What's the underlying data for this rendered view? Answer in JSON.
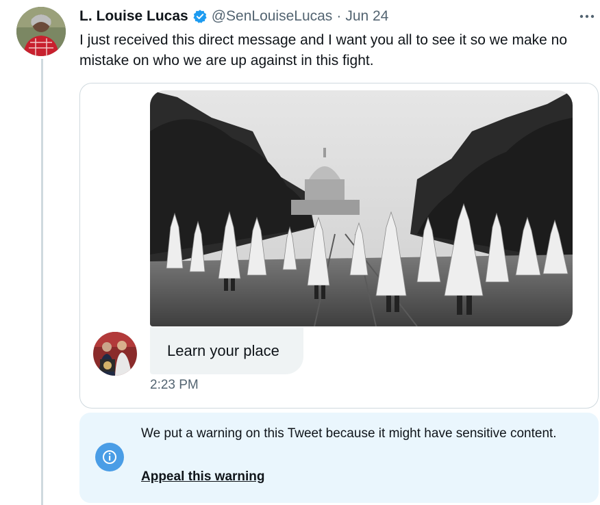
{
  "tweet": {
    "author": {
      "display_name": "L. Louise Lucas",
      "handle": "@SenLouiseLucas",
      "verified": true
    },
    "separator": "·",
    "date": "Jun 24",
    "more_icon": "more-horizontal-icon",
    "text": "I just received this direct message and I want you all to see it so we make no mistake on who we are up against in this fight."
  },
  "dm_screenshot": {
    "message_text": "Learn your place",
    "timestamp": "2:23 PM"
  },
  "warning": {
    "icon": "info-icon",
    "message": "We put a warning on this Tweet because it might have sensitive content.",
    "appeal_label": "Appeal this warning"
  },
  "colors": {
    "verified_blue": "#1d9bf0",
    "info_blue": "#4a9de6",
    "warning_bg": "#eaf6fd",
    "secondary_text": "#536471"
  }
}
